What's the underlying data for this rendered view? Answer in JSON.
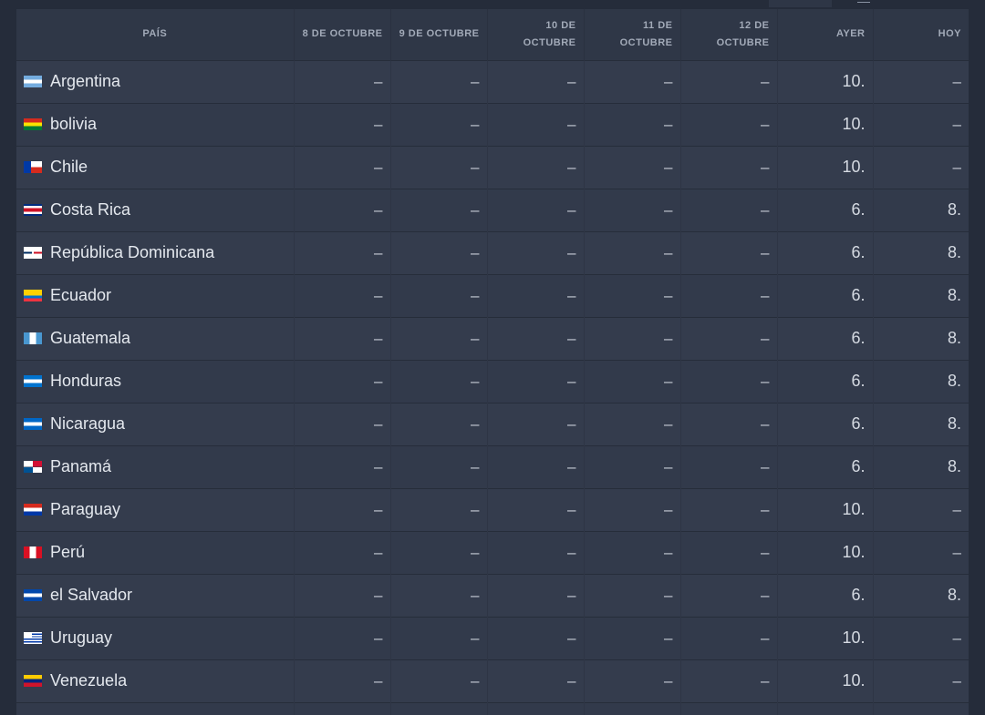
{
  "columns": {
    "country": "PAÍS",
    "d8": "8 DE OCTUBRE",
    "d9": "9 DE OCTUBRE",
    "d10": "10 DE OCTUBRE",
    "d11": "11 DE OCTUBRE",
    "d12": "12 DE OCTUBRE",
    "ayer": "AYER",
    "hoy": "HOY"
  },
  "rows": [
    {
      "country": "Argentina",
      "flag": "argentina-flag-icon",
      "d8": "–",
      "d9": "–",
      "d10": "–",
      "d11": "–",
      "d12": "–",
      "ayer": "10.",
      "hoy": "–"
    },
    {
      "country": "bolivia",
      "flag": "bolivia-flag-icon",
      "d8": "–",
      "d9": "–",
      "d10": "–",
      "d11": "–",
      "d12": "–",
      "ayer": "10.",
      "hoy": "–"
    },
    {
      "country": "Chile",
      "flag": "chile-flag-icon",
      "d8": "–",
      "d9": "–",
      "d10": "–",
      "d11": "–",
      "d12": "–",
      "ayer": "10.",
      "hoy": "–"
    },
    {
      "country": "Costa Rica",
      "flag": "costa-rica-flag-icon",
      "d8": "–",
      "d9": "–",
      "d10": "–",
      "d11": "–",
      "d12": "–",
      "ayer": "6.",
      "hoy": "8."
    },
    {
      "country": "República Dominicana",
      "flag": "dominican-republic-flag-icon",
      "d8": "–",
      "d9": "–",
      "d10": "–",
      "d11": "–",
      "d12": "–",
      "ayer": "6.",
      "hoy": "8."
    },
    {
      "country": "Ecuador",
      "flag": "ecuador-flag-icon",
      "d8": "–",
      "d9": "–",
      "d10": "–",
      "d11": "–",
      "d12": "–",
      "ayer": "6.",
      "hoy": "8."
    },
    {
      "country": "Guatemala",
      "flag": "guatemala-flag-icon",
      "d8": "–",
      "d9": "–",
      "d10": "–",
      "d11": "–",
      "d12": "–",
      "ayer": "6.",
      "hoy": "8."
    },
    {
      "country": "Honduras",
      "flag": "honduras-flag-icon",
      "d8": "–",
      "d9": "–",
      "d10": "–",
      "d11": "–",
      "d12": "–",
      "ayer": "6.",
      "hoy": "8."
    },
    {
      "country": "Nicaragua",
      "flag": "nicaragua-flag-icon",
      "d8": "–",
      "d9": "–",
      "d10": "–",
      "d11": "–",
      "d12": "–",
      "ayer": "6.",
      "hoy": "8."
    },
    {
      "country": "Panamá",
      "flag": "panama-flag-icon",
      "d8": "–",
      "d9": "–",
      "d10": "–",
      "d11": "–",
      "d12": "–",
      "ayer": "6.",
      "hoy": "8."
    },
    {
      "country": "Paraguay",
      "flag": "paraguay-flag-icon",
      "d8": "–",
      "d9": "–",
      "d10": "–",
      "d11": "–",
      "d12": "–",
      "ayer": "10.",
      "hoy": "–"
    },
    {
      "country": "Perú",
      "flag": "peru-flag-icon",
      "d8": "–",
      "d9": "–",
      "d10": "–",
      "d11": "–",
      "d12": "–",
      "ayer": "10.",
      "hoy": "–"
    },
    {
      "country": "el Salvador",
      "flag": "el-salvador-flag-icon",
      "d8": "–",
      "d9": "–",
      "d10": "–",
      "d11": "–",
      "d12": "–",
      "ayer": "6.",
      "hoy": "8."
    },
    {
      "country": "Uruguay",
      "flag": "uruguay-flag-icon",
      "d8": "–",
      "d9": "–",
      "d10": "–",
      "d11": "–",
      "d12": "–",
      "ayer": "10.",
      "hoy": "–"
    },
    {
      "country": "Venezuela",
      "flag": "venezuela-flag-icon",
      "d8": "–",
      "d9": "–",
      "d10": "–",
      "d11": "–",
      "d12": "–",
      "ayer": "10.",
      "hoy": "–"
    }
  ],
  "colors": {
    "background": "#252c3a",
    "header_bg": "#2f3747",
    "row_bg": "#343c4d",
    "text": "#d5dae2",
    "header_text": "#a2aab8"
  }
}
